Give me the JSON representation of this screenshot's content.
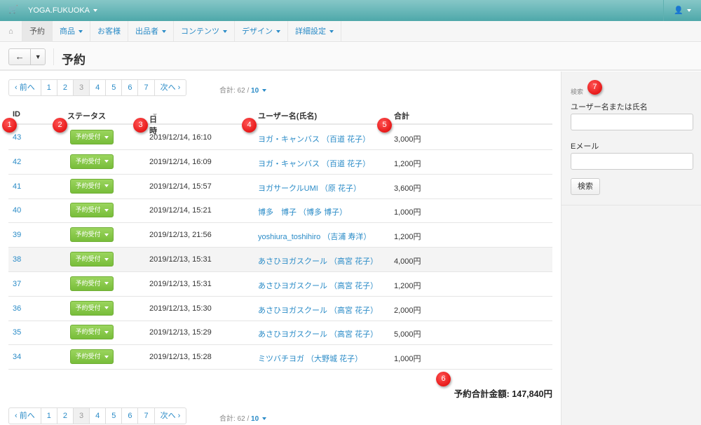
{
  "topbar": {
    "brand": "YOGA.FUKUOKA",
    "cart_icon": "cart-icon",
    "user_icon": "user-icon"
  },
  "nav": [
    "予約",
    "商品",
    "お客様",
    "出品者",
    "コンテンツ",
    "デザイン",
    "詳細設定"
  ],
  "title": "予約",
  "pagination": {
    "prev": "‹ 前へ",
    "pages": [
      "1",
      "2",
      "3",
      "4",
      "5",
      "6",
      "7"
    ],
    "current": "3",
    "next": "次へ ›",
    "total_label": "合計: 62 / ",
    "per_page": "10"
  },
  "table": {
    "headers": [
      "ID",
      "ステータス",
      "日時",
      "ユーザー名(氏名)",
      "合計"
    ],
    "rows": [
      {
        "id": "43",
        "status": "予約受付",
        "date": "2019/12/14, 16:10",
        "user": "ヨガ・キャンバス （百道 花子）",
        "total": "3,000円"
      },
      {
        "id": "42",
        "status": "予約受付",
        "date": "2019/12/14, 16:09",
        "user": "ヨガ・キャンバス （百道 花子）",
        "total": "1,200円"
      },
      {
        "id": "41",
        "status": "予約受付",
        "date": "2019/12/14, 15:57",
        "user": "ヨガサークルUMI （原 花子）",
        "total": "3,600円"
      },
      {
        "id": "40",
        "status": "予約受付",
        "date": "2019/12/14, 15:21",
        "user": "博多　博子 （博多 博子）",
        "total": "1,000円"
      },
      {
        "id": "39",
        "status": "予約受付",
        "date": "2019/12/13, 21:56",
        "user": "yoshiura_toshihiro （吉浦 寿洋）",
        "total": "1,200円"
      },
      {
        "id": "38",
        "status": "予約受付",
        "date": "2019/12/13, 15:31",
        "user": "あさひヨガスクール （高宮 花子）",
        "total": "4,000円"
      },
      {
        "id": "37",
        "status": "予約受付",
        "date": "2019/12/13, 15:31",
        "user": "あさひヨガスクール （高宮 花子）",
        "total": "1,200円"
      },
      {
        "id": "36",
        "status": "予約受付",
        "date": "2019/12/13, 15:30",
        "user": "あさひヨガスクール （高宮 花子）",
        "total": "2,000円"
      },
      {
        "id": "35",
        "status": "予約受付",
        "date": "2019/12/13, 15:29",
        "user": "あさひヨガスクール （高宮 花子）",
        "total": "5,000円"
      },
      {
        "id": "34",
        "status": "予約受付",
        "date": "2019/12/13, 15:28",
        "user": "ミツバチヨガ （大野城 花子）",
        "total": "1,000円"
      }
    ]
  },
  "grand_total": "予約合計金額: 147,840円",
  "sidebar": {
    "heading": "検索",
    "name_label": "ユーザー名または氏名",
    "name_value": "",
    "email_label": "Eメール",
    "email_value": "",
    "search_button": "検索"
  },
  "badges": [
    "1",
    "2",
    "3",
    "4",
    "5",
    "6",
    "7"
  ]
}
